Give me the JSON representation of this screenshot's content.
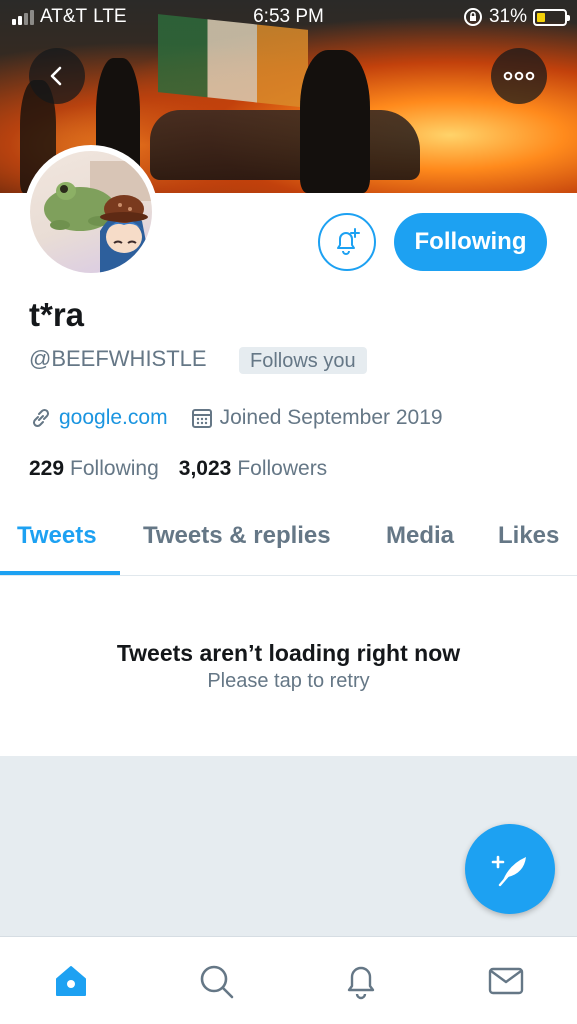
{
  "status_bar": {
    "carrier": "AT&T",
    "network": "LTE",
    "time": "6:53 PM",
    "battery": "31%",
    "battery_level": 0.31,
    "battery_color": "#f5d20a"
  },
  "header": {
    "back_icon": "chevron-left-icon",
    "more_icon": "more-horizontal-icon"
  },
  "profile": {
    "name": "t*ra",
    "handle": "@BEEFWHISTLE",
    "follows_you": "Follows you",
    "website": "google.com",
    "joined": "Joined September 2019",
    "following_count": "229",
    "following_label": "Following",
    "followers_count": "3,023",
    "followers_label": "Followers",
    "follow_button": "Following",
    "notify_icon": "bell-plus-icon"
  },
  "tabs": [
    {
      "label": "Tweets",
      "active": true
    },
    {
      "label": "Tweets & replies",
      "active": false
    },
    {
      "label": "Media",
      "active": false
    },
    {
      "label": "Likes",
      "active": false
    }
  ],
  "empty_state": {
    "title": "Tweets aren’t loading right now",
    "subtitle": "Please tap to retry"
  },
  "bottom_nav": [
    {
      "icon": "home-icon",
      "active": true
    },
    {
      "icon": "search-icon",
      "active": false
    },
    {
      "icon": "notifications-icon",
      "active": false
    },
    {
      "icon": "messages-icon",
      "active": false
    }
  ],
  "colors": {
    "accent": "#1da1f2",
    "secondary_text": "#657786",
    "primary_text": "#14171a",
    "link": "#1b95e0"
  }
}
